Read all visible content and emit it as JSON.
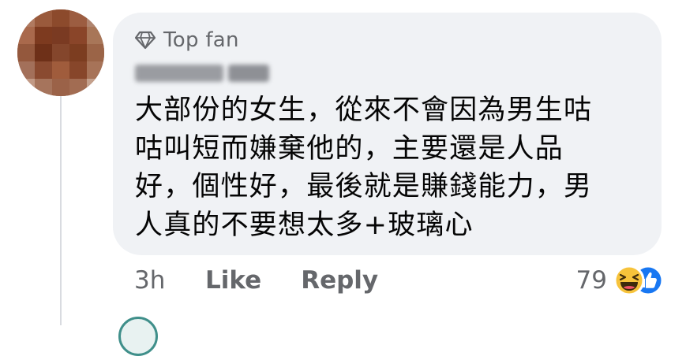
{
  "comment": {
    "badge": {
      "icon": "diamond-icon",
      "label": "Top fan"
    },
    "author": {
      "name_redacted": true
    },
    "text_lines": [
      "大部份的女生，從來不會因為男生咕",
      "咕叫短而嫌棄他的，主要還是人品",
      "好，個性好，最後就是賺錢能力，男",
      "人真的不要想太多+玻璃心"
    ],
    "timestamp": "3h",
    "like_label": "Like",
    "reply_label": "Reply",
    "reaction_count": "79",
    "reactions": [
      "haha-icon",
      "like-icon"
    ]
  },
  "colors": {
    "bubble": "#f0f2f5",
    "secondary_text": "#65676b",
    "primary_text": "#050505",
    "like_blue": "#1877f2",
    "haha_yellow": "#f7c33b"
  }
}
